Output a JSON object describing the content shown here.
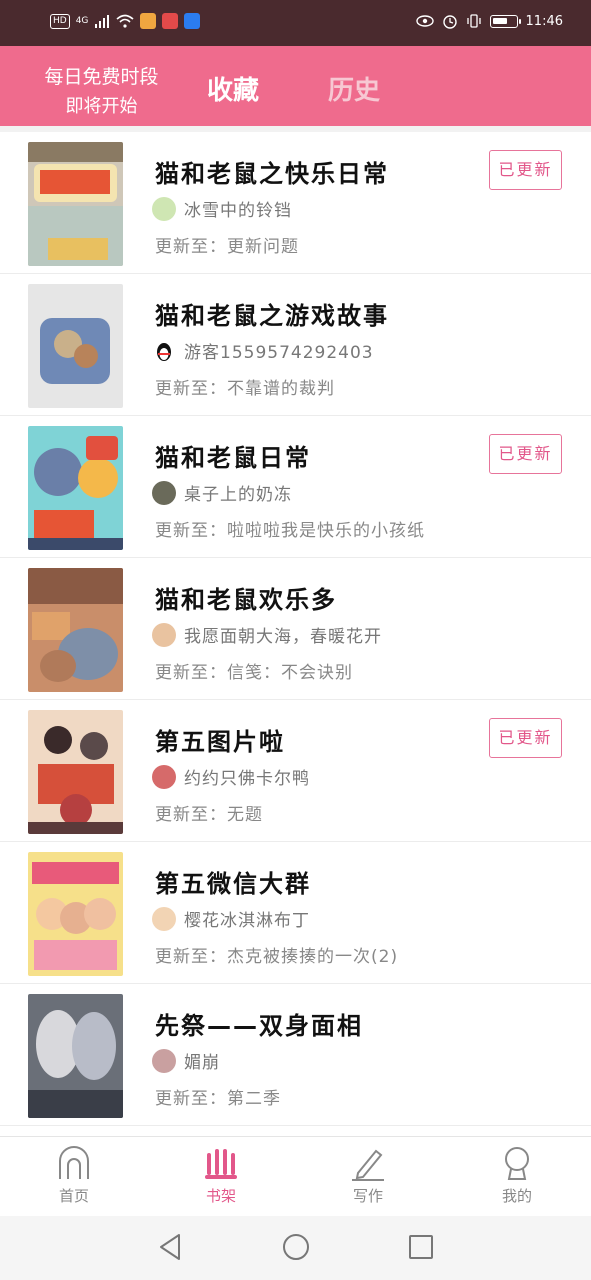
{
  "status_bar": {
    "left_indicators": [
      "HD",
      "4G"
    ],
    "time": "11:46",
    "battery_level": 0.7
  },
  "header": {
    "promo_line1": "每日免费时段",
    "promo_line2": "即将开始",
    "tabs": [
      {
        "label": "收藏",
        "active": true
      },
      {
        "label": "历史",
        "active": false
      }
    ]
  },
  "list": {
    "update_prefix": "更新至：",
    "badge_label": "已更新",
    "items": [
      {
        "title": "猫和老鼠之快乐日常",
        "author": "冰雪中的铃铛",
        "update": "更新至：更新问题",
        "badge": "已更新"
      },
      {
        "title": "猫和老鼠之游戏故事",
        "author": "游客1559574292403",
        "update": "更新至：不靠谱的裁判",
        "badge": ""
      },
      {
        "title": "猫和老鼠日常",
        "author": "桌子上的奶冻",
        "update": "更新至：啦啦啦我是快乐的小孩纸",
        "badge": "已更新"
      },
      {
        "title": "猫和老鼠欢乐多",
        "author": "我愿面朝大海，春暖花开",
        "update": "更新至：信笺：不会诀别",
        "badge": ""
      },
      {
        "title": "第五图片啦",
        "author": "约约只佛卡尔鸭",
        "update": "更新至：无题",
        "badge": "已更新"
      },
      {
        "title": "第五微信大群",
        "author": "樱花冰淇淋布丁",
        "update": "更新至：杰克被揍揍的一次(2)",
        "badge": ""
      },
      {
        "title": "先祭——双身面相",
        "author": "媚崩",
        "update": "更新至：第二季",
        "badge": ""
      }
    ]
  },
  "bottom_nav": {
    "items": [
      {
        "label": "首页",
        "icon": "home-arch-icon",
        "active": false
      },
      {
        "label": "书架",
        "icon": "bookshelf-icon",
        "active": true
      },
      {
        "label": "写作",
        "icon": "pen-icon",
        "active": false
      },
      {
        "label": "我的",
        "icon": "user-head-icon",
        "active": false
      }
    ]
  },
  "colors": {
    "brand_pink": "#ef6b8d",
    "status_bar": "#4a2a2e",
    "badge_border": "#e7749a",
    "active_nav": "#e2578a"
  }
}
